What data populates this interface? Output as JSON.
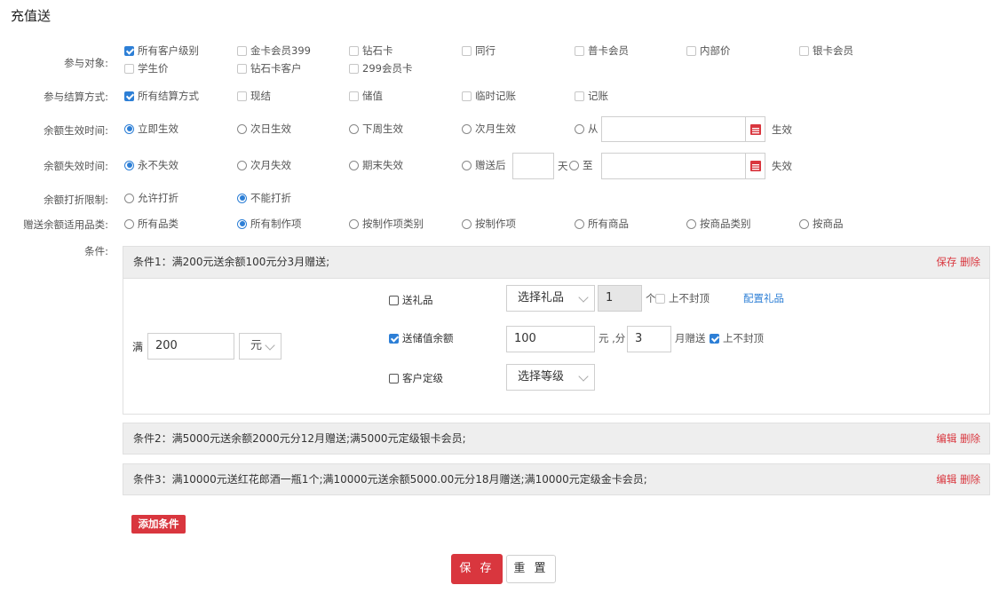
{
  "page": {
    "title": "充值送"
  },
  "targets": {
    "label": "参与对象:",
    "options": [
      {
        "label": "所有客户级别",
        "checked": true
      },
      {
        "label": "金卡会员399",
        "checked": false
      },
      {
        "label": "钻石卡",
        "checked": false
      },
      {
        "label": "同行",
        "checked": false
      },
      {
        "label": "普卡会员",
        "checked": false
      },
      {
        "label": "内部价",
        "checked": false
      },
      {
        "label": "银卡会员",
        "checked": false
      },
      {
        "label": "学生价",
        "checked": false
      },
      {
        "label": "钻石卡客户",
        "checked": false
      },
      {
        "label": "299会员卡",
        "checked": false
      }
    ]
  },
  "settlement": {
    "label": "参与结算方式:",
    "options": [
      {
        "label": "所有结算方式",
        "checked": true
      },
      {
        "label": "现结",
        "checked": false
      },
      {
        "label": "储值",
        "checked": false
      },
      {
        "label": "临时记账",
        "checked": false
      },
      {
        "label": "记账",
        "checked": false
      }
    ]
  },
  "effective": {
    "label": "余额生效时间:",
    "options": [
      {
        "label": "立即生效",
        "selected": true
      },
      {
        "label": "次日生效",
        "selected": false
      },
      {
        "label": "下周生效",
        "selected": false
      },
      {
        "label": "次月生效",
        "selected": false
      },
      {
        "label": "从",
        "selected": false
      }
    ],
    "date_value": "",
    "suffix": "生效"
  },
  "expiry": {
    "label": "余额失效时间:",
    "options": [
      {
        "label": "永不失效",
        "selected": true
      },
      {
        "label": "次月失效",
        "selected": false
      },
      {
        "label": "期末失效",
        "selected": false
      },
      {
        "label": "赠送后",
        "selected": false
      },
      {
        "label": "至",
        "selected": false
      }
    ],
    "days_value": "",
    "days_unit": "天",
    "date_value": "",
    "suffix": "失效"
  },
  "discount": {
    "label": "余额打折限制:",
    "options": [
      {
        "label": "允许打折",
        "selected": false
      },
      {
        "label": "不能打折",
        "selected": true
      }
    ]
  },
  "applicable": {
    "label": "赠送余额适用品类:",
    "options": [
      {
        "label": "所有品类",
        "selected": false
      },
      {
        "label": "所有制作项",
        "selected": true
      },
      {
        "label": "按制作项类别",
        "selected": false
      },
      {
        "label": "按制作项",
        "selected": false
      },
      {
        "label": "所有商品",
        "selected": false
      },
      {
        "label": "按商品类别",
        "selected": false
      },
      {
        "label": "按商品",
        "selected": false
      }
    ]
  },
  "conditions": {
    "label": "条件:",
    "items": [
      {
        "text": "条件1：满200元送余额100元分3月赠送;",
        "action1": "保存",
        "action2": "删除"
      },
      {
        "text": "条件2：满5000元送余额2000元分12月赠送;满5000元定级银卡会员;",
        "action1": "编辑",
        "action2": "删除"
      },
      {
        "text": "条件3：满10000元送红花郎酒一瓶1个;满10000元送余额5000.00元分18月赠送;满10000元定级金卡会员;",
        "action1": "编辑",
        "action2": "删除"
      }
    ],
    "editor": {
      "amount_label": "满",
      "amount_value": "200",
      "unit_select": "元",
      "gift": {
        "label": "送礼品",
        "checked": false,
        "select": "选择礼品",
        "qty": "1",
        "qty_unit": "个",
        "cap_label": "上不封顶",
        "cap_checked": false,
        "config_link": "配置礼品"
      },
      "balance": {
        "label": "送储值余额",
        "checked": true,
        "value": "100",
        "unit": "元 ,分",
        "months": "3",
        "months_unit": "月赠送",
        "cap_label": "上不封顶",
        "cap_checked": true
      },
      "level": {
        "label": "客户定级",
        "checked": false,
        "select": "选择等级"
      }
    }
  },
  "buttons": {
    "add_condition": "添加条件",
    "save": "保 存",
    "reset": "重 置"
  }
}
